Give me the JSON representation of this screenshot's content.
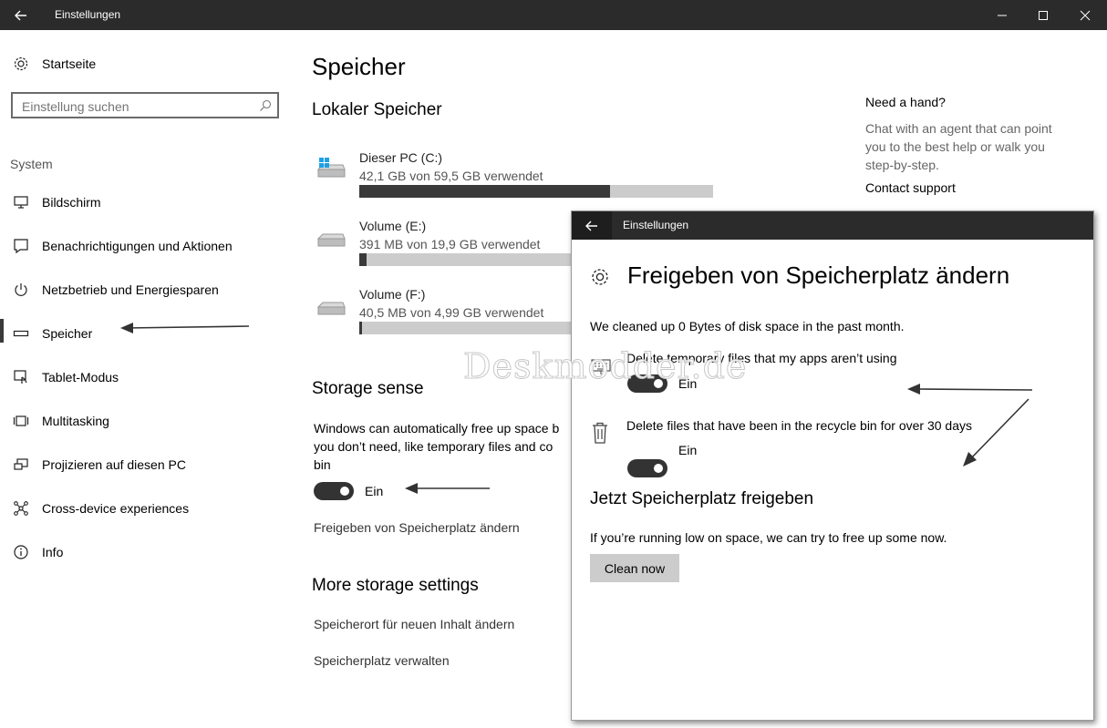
{
  "window": {
    "title": "Einstellungen"
  },
  "sidebar": {
    "home_label": "Startseite",
    "search_placeholder": "Einstellung suchen",
    "section_label": "System",
    "items": [
      {
        "label": "Bildschirm",
        "icon": "monitor-icon"
      },
      {
        "label": "Benachrichtigungen und Aktionen",
        "icon": "notification-icon"
      },
      {
        "label": "Netzbetrieb und Energiesparen",
        "icon": "power-icon"
      },
      {
        "label": "Speicher",
        "icon": "storage-icon",
        "active": true
      },
      {
        "label": "Tablet-Modus",
        "icon": "tablet-icon"
      },
      {
        "label": "Multitasking",
        "icon": "multitasking-icon"
      },
      {
        "label": "Projizieren auf diesen PC",
        "icon": "project-icon"
      },
      {
        "label": "Cross-device experiences",
        "icon": "cross-device-icon"
      },
      {
        "label": "Info",
        "icon": "info-icon"
      }
    ]
  },
  "main": {
    "title": "Speicher",
    "local_storage_heading": "Lokaler Speicher",
    "drives": [
      {
        "name": "Dieser PC (C:)",
        "usage": "42,1 GB von 59,5 GB verwendet",
        "fraction": 0.708
      },
      {
        "name": "Volume (E:)",
        "usage": "391 MB von 19,9 GB verwendet",
        "fraction": 0.02
      },
      {
        "name": "Volume (F:)",
        "usage": "40,5 MB von 4,99 GB verwendet",
        "fraction": 0.008
      }
    ],
    "storage_sense_heading": "Storage sense",
    "storage_sense_text_line1": "Windows can automatically free up space b",
    "storage_sense_text_line2": "you don’t need, like temporary files and co",
    "storage_sense_text_line3": "bin",
    "storage_sense_toggle_label": "Ein",
    "change_link": "Freigeben von Speicherplatz ändern",
    "more_heading": "More storage settings",
    "more_links": [
      "Speicherort für neuen Inhalt ändern",
      "Speicherplatz verwalten"
    ]
  },
  "help": {
    "title": "Need a hand?",
    "text_line1": "Chat with an agent that can point",
    "text_line2": "you to the best help or walk you",
    "text_line3": "step-by-step.",
    "contact_link": "Contact support"
  },
  "overlay": {
    "window_title": "Einstellungen",
    "heading": "Freigeben von Speicherplatz ändern",
    "cleaned_text": "We cleaned up 0 Bytes of disk space in the past month.",
    "option1_label": "Delete temporary files that my apps aren’t using",
    "option1_toggle": "Ein",
    "option2_label": "Delete files that have been in the recycle bin for over 30 days",
    "option2_toggle": "Ein",
    "free_now_heading": "Jetzt Speicherplatz freigeben",
    "free_now_text": "If you’re running low on space, we can try to free up some now.",
    "clean_button": "Clean now"
  },
  "watermark": "Deskmodder.de",
  "colors": {
    "titlebar": "#2b2b2b",
    "toggle_on": "#333333",
    "bar_fill": "#3a3a3a",
    "bar_track": "#cccccc"
  }
}
